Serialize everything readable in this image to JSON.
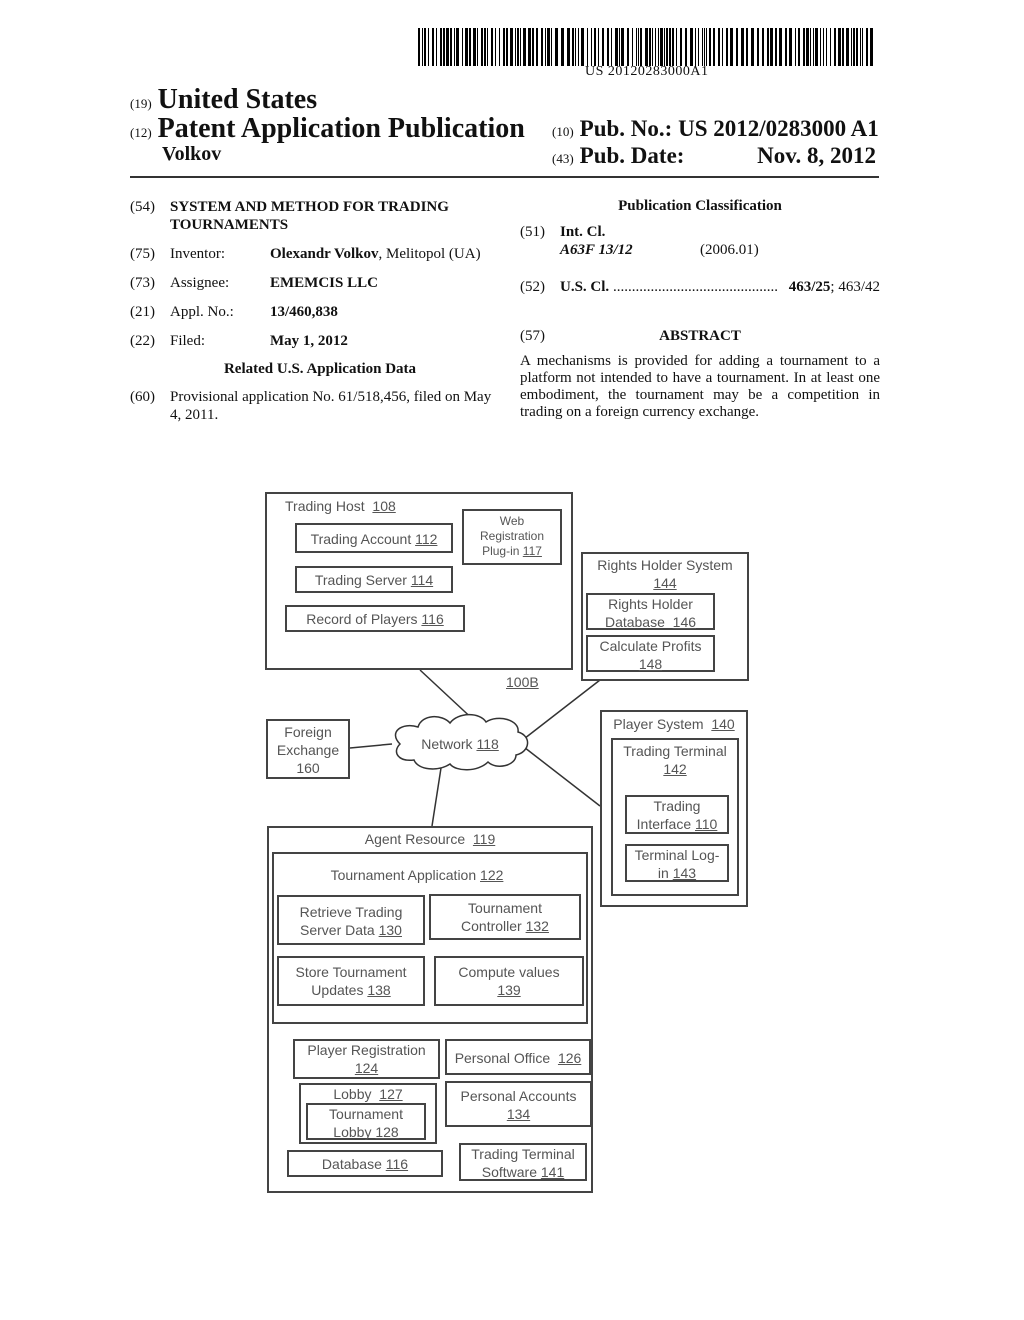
{
  "header": {
    "barcode_text": "US 20120283000A1",
    "country_code": "(19)",
    "country": "United States",
    "doc_type_code": "(12)",
    "doc_type": "Patent Application Publication",
    "inventor_surname": "Volkov",
    "pub_no_code": "(10)",
    "pub_no_label": "Pub. No.:",
    "pub_no": "US 2012/0283000 A1",
    "pub_date_code": "(43)",
    "pub_date_label": "Pub. Date:",
    "pub_date": "Nov. 8, 2012"
  },
  "biblio": {
    "title_code": "(54)",
    "title_line1": "SYSTEM AND METHOD FOR TRADING",
    "title_line2": "TOURNAMENTS",
    "inventor_code": "(75)",
    "inventor_label": "Inventor:",
    "inventor_name": "Olexandr Volkov",
    "inventor_location": ", Melitopol (UA)",
    "assignee_code": "(73)",
    "assignee_label": "Assignee:",
    "assignee": "EMEMCIS LLC",
    "appl_code": "(21)",
    "appl_label": "Appl. No.:",
    "appl_no": "13/460,838",
    "filed_code": "(22)",
    "filed_label": "Filed:",
    "filed": "May 1, 2012",
    "related_heading": "Related U.S. Application Data",
    "provisional_code": "(60)",
    "provisional_line1": "Provisional application No. 61/518,456, filed on May",
    "provisional_line2": "4, 2011."
  },
  "classification": {
    "heading": "Publication Classification",
    "int_code": "(51)",
    "int_label": "Int. Cl.",
    "int_class": "A63F 13/12",
    "int_version": "(2006.01)",
    "us_code": "(52)",
    "us_label": "U.S. Cl.",
    "us_dots": "............................................",
    "us_primary": "463/25",
    "us_secondary": "; 463/42"
  },
  "abstract": {
    "code": "(57)",
    "heading": "ABSTRACT",
    "text": "A mechanisms is provided for adding a tournament to a platform not intended to have a tournament. In at least one embodiment, the tournament may be a competition in trading on a foreign currency exchange."
  },
  "diagram": {
    "figure_ref": "100B",
    "trading_host": {
      "label": "Trading Host",
      "ref": "108"
    },
    "trading_account": {
      "label": "Trading Account",
      "ref": "112"
    },
    "web_registration": {
      "line1": "Web",
      "line2": "Registration",
      "line3": "Plug-in",
      "ref": "117"
    },
    "trading_server": {
      "label": "Trading Server",
      "ref": "114"
    },
    "record_of_players": {
      "label": "Record of Players",
      "ref": "116"
    },
    "rights_holder_system": {
      "label": "Rights Holder System",
      "ref": "144"
    },
    "rights_holder_db": {
      "line1": "Rights Holder",
      "line2": "Database",
      "ref": "146"
    },
    "calculate_profits": {
      "label": "Calculate Profits",
      "ref": "148"
    },
    "foreign_exchange": {
      "line1": "Foreign",
      "line2": "Exchange",
      "line3": "160"
    },
    "network": {
      "label": "Network",
      "ref": "118"
    },
    "player_system": {
      "label": "Player System",
      "ref": "140"
    },
    "trading_terminal": {
      "label": "Trading Terminal",
      "ref": "142"
    },
    "trading_interface": {
      "line1": "Trading",
      "line2": "Interface",
      "ref": "110"
    },
    "terminal_login": {
      "line1": "Terminal Log-",
      "line2": "in",
      "ref": "143"
    },
    "agent_resource": {
      "label": "Agent Resource",
      "ref": "119"
    },
    "tournament_application": {
      "label": "Tournament Application",
      "ref": "122"
    },
    "retrieve_trading": {
      "line1": "Retrieve Trading",
      "line2": "Server Data",
      "ref": "130"
    },
    "tournament_controller": {
      "line1": "Tournament",
      "line2": "Controller",
      "ref": "132"
    },
    "store_updates": {
      "line1": "Store Tournament",
      "line2": "Updates",
      "ref": "138"
    },
    "compute_values": {
      "line1": "Compute values",
      "ref": "139"
    },
    "player_registration": {
      "line1": "Player Registration",
      "ref": "124"
    },
    "personal_office": {
      "label": "Personal Office",
      "ref": "126"
    },
    "lobby": {
      "label": "Lobby",
      "ref": "127"
    },
    "tournament_lobby": {
      "line1": "Tournament",
      "line2": "Lobby",
      "ref": "128"
    },
    "personal_accounts": {
      "line1": "Personal Accounts",
      "ref": "134"
    },
    "database": {
      "label": "Database",
      "ref": "116"
    },
    "trading_terminal_software": {
      "line1": "Trading Terminal",
      "line2": "Software",
      "ref": "141"
    }
  }
}
